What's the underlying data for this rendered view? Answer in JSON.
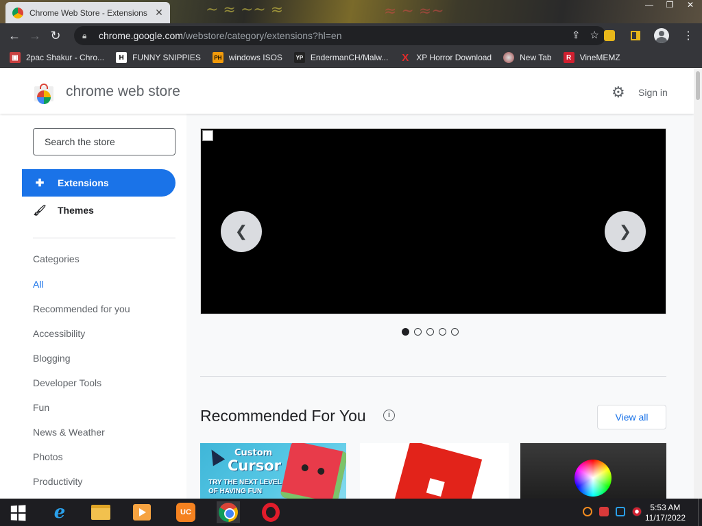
{
  "browser": {
    "tab_title": "Chrome Web Store - Extensions",
    "url_host": "chrome.google.com",
    "url_path": "/webstore/category/extensions?hl=en",
    "bookmarks": [
      {
        "label": "2pac Shakur - Chro...",
        "icon": "bookmark-favicon-1"
      },
      {
        "label": "FUNNY SNIPPIES",
        "icon": "H"
      },
      {
        "label": "windows ISOS",
        "icon": "PH"
      },
      {
        "label": "EndermanCH/Malw...",
        "icon": "YP"
      },
      {
        "label": "XP Horror Download",
        "icon": "X"
      },
      {
        "label": "New Tab",
        "icon": "new-tab-favicon"
      },
      {
        "label": "VineMEMZ",
        "icon": "R"
      }
    ]
  },
  "store": {
    "title": "chrome web store",
    "signin": "Sign in",
    "search_placeholder": "Search the store",
    "nav": {
      "extensions": "Extensions",
      "themes": "Themes"
    },
    "categories_heading": "Categories",
    "categories": [
      "All",
      "Recommended for you",
      "Accessibility",
      "Blogging",
      "Developer Tools",
      "Fun",
      "News & Weather",
      "Photos",
      "Productivity"
    ],
    "active_category": "All",
    "carousel": {
      "slides": 5,
      "active_slide": 1
    },
    "recommended": {
      "title": "Recommended For You",
      "view_all": "View all",
      "card1": {
        "title": "Custom",
        "title2": "Cursor",
        "subtitle1": "TRY THE NEXT LEVEL",
        "subtitle2": "OF HAVING FUN"
      }
    }
  },
  "taskbar": {
    "time": "5:53 AM",
    "date": "11/17/2022",
    "apps": [
      "internet-explorer",
      "file-explorer",
      "media-player",
      "uc-browser",
      "chrome",
      "opera"
    ]
  },
  "colors": {
    "accent": "#1a73e8",
    "toolbar": "#35363a"
  }
}
